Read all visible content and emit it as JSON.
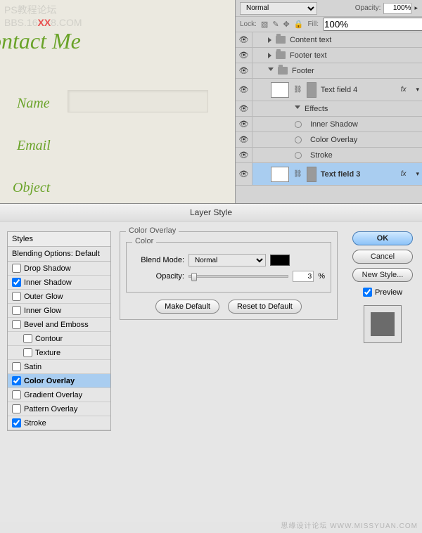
{
  "watermark": {
    "line1": "PS教程论坛",
    "line2a": "BBS.16",
    "line2b": "XX",
    "line2c": "8.COM"
  },
  "contact": {
    "title": "ontact Me",
    "name": "Name",
    "email": "Email",
    "object": "Object"
  },
  "layersPanel": {
    "blendMode": "Normal",
    "opacityLbl": "Opacity:",
    "opacityVal": "100%",
    "lockLbl": "Lock:",
    "fillLbl": "Fill:",
    "fillVal": "100%",
    "groups": [
      "Content text",
      "Footer text",
      "Footer"
    ],
    "layer1": "Text field 4",
    "layer2": "Text field 3",
    "effects": "Effects",
    "eff": [
      "Inner Shadow",
      "Color Overlay",
      "Stroke"
    ],
    "fx": "fx"
  },
  "dialog": {
    "title": "Layer Style",
    "stylesHead": "Styles",
    "blendingDefault": "Blending Options: Default",
    "items": {
      "dropShadow": "Drop Shadow",
      "innerShadow": "Inner Shadow",
      "outerGlow": "Outer Glow",
      "innerGlow": "Inner Glow",
      "bevel": "Bevel and Emboss",
      "contour": "Contour",
      "texture": "Texture",
      "satin": "Satin",
      "colorOverlay": "Color Overlay",
      "gradientOverlay": "Gradient Overlay",
      "patternOverlay": "Pattern Overlay",
      "stroke": "Stroke"
    },
    "group": {
      "overlay": "Color Overlay",
      "color": "Color"
    },
    "blendModeLbl": "Blend Mode:",
    "blendModeVal": "Normal",
    "opacityLbl": "Opacity:",
    "opacityVal": "3",
    "pct": "%",
    "makeDefault": "Make Default",
    "resetDefault": "Reset to Default",
    "ok": "OK",
    "cancel": "Cancel",
    "newStyle": "New Style...",
    "preview": "Preview"
  },
  "footerwm": "思缘设计论坛  WWW.MISSYUAN.COM"
}
